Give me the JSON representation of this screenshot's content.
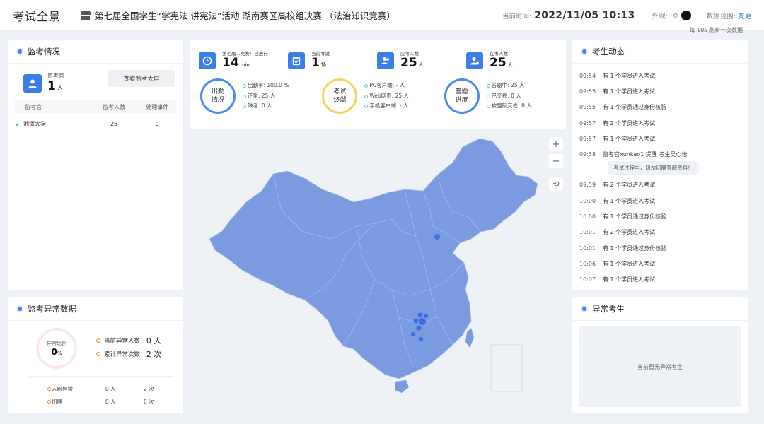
{
  "header": {
    "app_title": "考试全景",
    "exam_name": "第七届全国学生“学宪法 讲宪法”活动 湖南赛区高校组决赛 （法治知识竞赛）",
    "time_label": "当前时间:",
    "time_value": "2022/11/05 10:13",
    "theme_label": "外观:",
    "range_label": "数据范围:",
    "range_link": "变更",
    "refresh_note": "每 10s 刷新一次数据"
  },
  "monitor": {
    "title": "监考情况",
    "invigilator_label": "监考官",
    "invigilator_count": "1",
    "invigilator_unit": "人",
    "view_big_screen": "查看监考大屏",
    "columns": [
      "监考官",
      "监考人数",
      "处理事件"
    ],
    "rows": [
      {
        "name": "湘潭大学",
        "count": "25",
        "events": "0"
      }
    ]
  },
  "abnormal": {
    "title": "监考异常数据",
    "ratio_label": "异常比例",
    "ratio_value": "0",
    "ratio_unit": "%",
    "current_label": "当前异常人数:",
    "current_value": "0 人",
    "total_label": "累计异常次数:",
    "total_value": "2 次",
    "rows": [
      {
        "name": "人脸异常",
        "people": "0 人",
        "times": "2 次"
      },
      {
        "name": "切屏",
        "people": "0 人",
        "times": "0 次"
      }
    ]
  },
  "stats": {
    "top": [
      {
        "label": "第七届...竞赛）已进行",
        "value": "14",
        "unit": "min",
        "icon": "clock-icon"
      },
      {
        "label": "当前考试",
        "value": "1",
        "unit": "场",
        "icon": "clipboard-icon"
      },
      {
        "label": "应考人数",
        "value": "25",
        "unit": "人",
        "icon": "users-icon"
      },
      {
        "label": "在考人数",
        "value": "25",
        "unit": "人",
        "icon": "user-online-icon"
      }
    ],
    "groups": [
      {
        "circle": "出勤\n情况",
        "lines": [
          "出勤率: 100.0 %",
          "正常: 25 人",
          "缺考: 0 人"
        ]
      },
      {
        "circle": "考试\n终端",
        "lines": [
          "PC客户端: - 人",
          "Web网页: 25 人",
          "手机客户端: - 人"
        ]
      },
      {
        "circle": "答题\n进度",
        "lines": [
          "答题中: 25 人",
          "已交卷: 0 人",
          "被强制交卷: 0 人"
        ]
      }
    ]
  },
  "map": {
    "zoom_in": "+",
    "zoom_out": "−",
    "reset": "⟲",
    "fill_color": "#7b9be0",
    "marker_color": "#3a6ee8"
  },
  "activity": {
    "title": "考生动态",
    "items": [
      {
        "time": "09:54",
        "text": "有 1 个学员进入考试"
      },
      {
        "time": "09:55",
        "text": "有 1 个学员进入考试"
      },
      {
        "time": "09:55",
        "text": "有 1 个学员通过身份核验"
      },
      {
        "time": "09:57",
        "text": "有 2 个学员进入考试"
      },
      {
        "time": "09:57",
        "text": "有 1 个学员进入考试"
      },
      {
        "time": "09:58",
        "text": "监考官xunkao1 提醒 考生吴心怡"
      }
    ],
    "tip": "考试过程中，切勿切屏查阅资料！",
    "items2": [
      {
        "time": "09:59",
        "text": "有 2 个学员进入考试"
      },
      {
        "time": "10:00",
        "text": "有 1 个学员进入考试"
      },
      {
        "time": "10:00",
        "text": "有 1 个学员通过身份核验"
      },
      {
        "time": "10:01",
        "text": "有 2 个学员进入考试"
      },
      {
        "time": "10:01",
        "text": "有 1 个学员通过身份核验"
      },
      {
        "time": "10:06",
        "text": "有 1 个学员进入考试"
      },
      {
        "time": "10:07",
        "text": "有 1 个学员进入考试"
      }
    ]
  },
  "abnormal_students": {
    "title": "异常考生",
    "empty_text": "当前暂无异常考生"
  }
}
